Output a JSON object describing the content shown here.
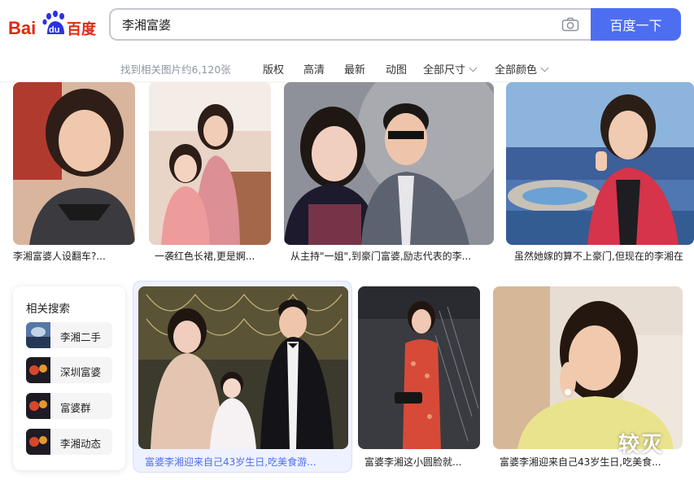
{
  "logo": {
    "text_left": "Bai",
    "text_du": "du",
    "text_cn": "百度"
  },
  "search": {
    "query": "李湘富婆",
    "button_label": "百度一下"
  },
  "filters": {
    "result_count": "找到相关图片约6,120张",
    "items": [
      "版权",
      "高清",
      "最新",
      "动图",
      "全部尺寸",
      "全部颜色"
    ]
  },
  "row1": [
    {
      "caption": "李湘富婆人设翻车?..."
    },
    {
      "caption": "一袭红色长裙,更是婀..."
    },
    {
      "caption": "从主持\"一姐\",到豪门富婆,励志代表的李..."
    },
    {
      "caption": "虽然她嫁的算不上豪门,但现在的李湘在"
    }
  ],
  "row2": [
    {
      "caption": "富婆李湘迎来自己43岁生日,吃美食游..."
    },
    {
      "caption": "富婆李湘这小圆脸就..."
    },
    {
      "caption": "富婆李湘迎来自己43岁生日,吃美食..."
    }
  ],
  "related": {
    "title": "相关搜索",
    "items": [
      "李湘二手",
      "深圳富婆",
      "富婆群",
      "李湘动态"
    ]
  },
  "watermark": "较灭",
  "colors": {
    "brand_blue": "#4e6ef2",
    "logo_red": "#de2910",
    "logo_blue": "#2932e1"
  }
}
